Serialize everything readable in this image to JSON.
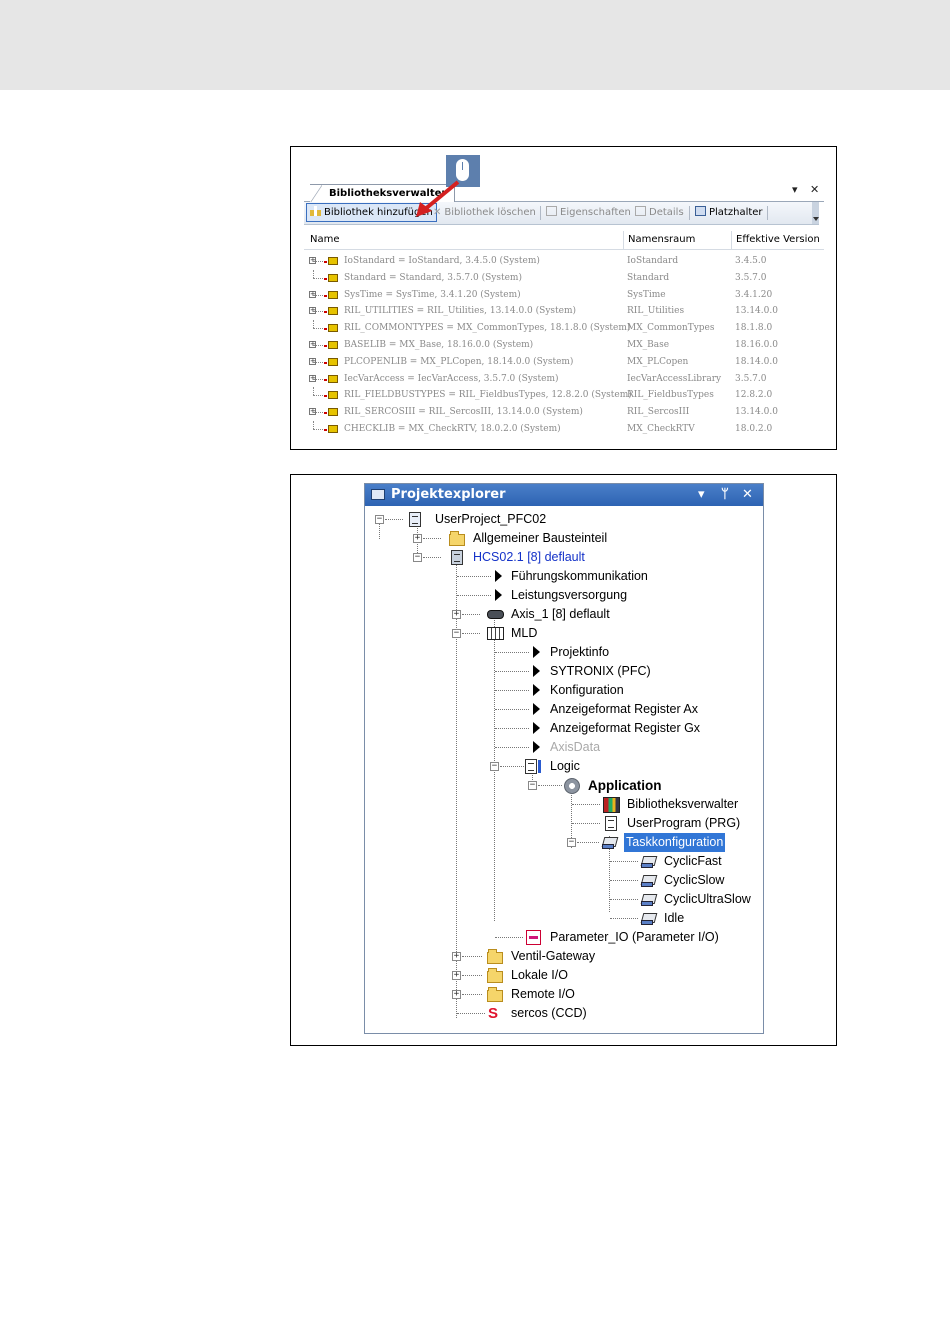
{
  "library_manager": {
    "tab_label": "Bibliotheksverwalter",
    "tab_dropdown": "▾",
    "tab_close": "✕",
    "toolbar": {
      "add_library": "Bibliothek hinzufügen",
      "delete_library": "Bibliothek löschen",
      "properties": "Eigenschaften",
      "details": "Details",
      "placeholder": "Platzhalter"
    },
    "columns": {
      "name": "Name",
      "namespace": "Namensraum",
      "effective_version": "Effektive Version"
    },
    "rows": [
      {
        "name": "IoStandard = IoStandard, 3.4.5.0 (System)",
        "namespace": "IoStandard",
        "version": "3.4.5.0",
        "expandable": true
      },
      {
        "name": "Standard = Standard, 3.5.7.0 (System)",
        "namespace": "Standard",
        "version": "3.5.7.0",
        "expandable": false
      },
      {
        "name": "SysTime = SysTime, 3.4.1.20 (System)",
        "namespace": "SysTime",
        "version": "3.4.1.20",
        "expandable": true
      },
      {
        "name": "RIL_UTILITIES = RIL_Utilities, 13.14.0.0 (System)",
        "namespace": "RIL_Utilities",
        "version": "13.14.0.0",
        "expandable": true
      },
      {
        "name": "RIL_COMMONTYPES = MX_CommonTypes, 18.1.8.0 (System)",
        "namespace": "MX_CommonTypes",
        "version": "18.1.8.0",
        "expandable": false
      },
      {
        "name": "BASELIB = MX_Base, 18.16.0.0 (System)",
        "namespace": "MX_Base",
        "version": "18.16.0.0",
        "expandable": true
      },
      {
        "name": "PLCOPENLIB = MX_PLCopen, 18.14.0.0 (System)",
        "namespace": "MX_PLCopen",
        "version": "18.14.0.0",
        "expandable": true
      },
      {
        "name": "IecVarAccess = IecVarAccess, 3.5.7.0 (System)",
        "namespace": "IecVarAccessLibrary",
        "version": "3.5.7.0",
        "expandable": true
      },
      {
        "name": "RIL_FIELDBUSTYPES = RIL_FieldbusTypes, 12.8.2.0 (System)",
        "namespace": "RIL_FieldbusTypes",
        "version": "12.8.2.0",
        "expandable": false
      },
      {
        "name": "RIL_SERCOSIII = RIL_SercosIII, 13.14.0.0 (System)",
        "namespace": "RIL_SercosIII",
        "version": "13.14.0.0",
        "expandable": true
      },
      {
        "name": "CHECKLIB = MX_CheckRTV, 18.0.2.0 (System)",
        "namespace": "MX_CheckRTV",
        "version": "18.0.2.0",
        "expandable": false
      }
    ]
  },
  "project_explorer": {
    "title": "Projektexplorer",
    "controls": {
      "dropdown": "▾",
      "pin": "ᛘ",
      "close": "✕"
    },
    "tree": {
      "project": "UserProject_PFC02",
      "general_component": "Allgemeiner Bausteinteil",
      "device": "HCS02.1 [8] deflault",
      "master_comm": "Führungskommunikation",
      "power_supply": "Leistungsversorgung",
      "axis": "Axis_1 [8] deflault",
      "mld": "MLD",
      "project_info": "Projektinfo",
      "sytronix": "SYTRONIX (PFC)",
      "configuration": "Konfiguration",
      "display_ax": "Anzeigeformat Register Ax",
      "display_gx": "Anzeigeformat Register Gx",
      "axis_data": "AxisData",
      "logic": "Logic",
      "application": "Application",
      "library_manager": "Bibliotheksverwalter",
      "user_program": "UserProgram (PRG)",
      "task_config": "Taskkonfiguration",
      "cyclic_fast": "CyclicFast",
      "cyclic_slow": "CyclicSlow",
      "cyclic_ultraslow": "CyclicUltraSlow",
      "idle": "Idle",
      "parameter_io": "Parameter_IO (Parameter I/O)",
      "valve_gateway": "Ventil-Gateway",
      "local_io": "Lokale I/O",
      "remote_io": "Remote I/O",
      "sercos": "sercos (CCD)",
      "sercos_icon_letter": "S"
    }
  },
  "colors": {
    "title_bar": "#2d63b3",
    "selection": "#3176d6",
    "device_text": "#1432c8",
    "callout_arrow": "#d42020"
  }
}
